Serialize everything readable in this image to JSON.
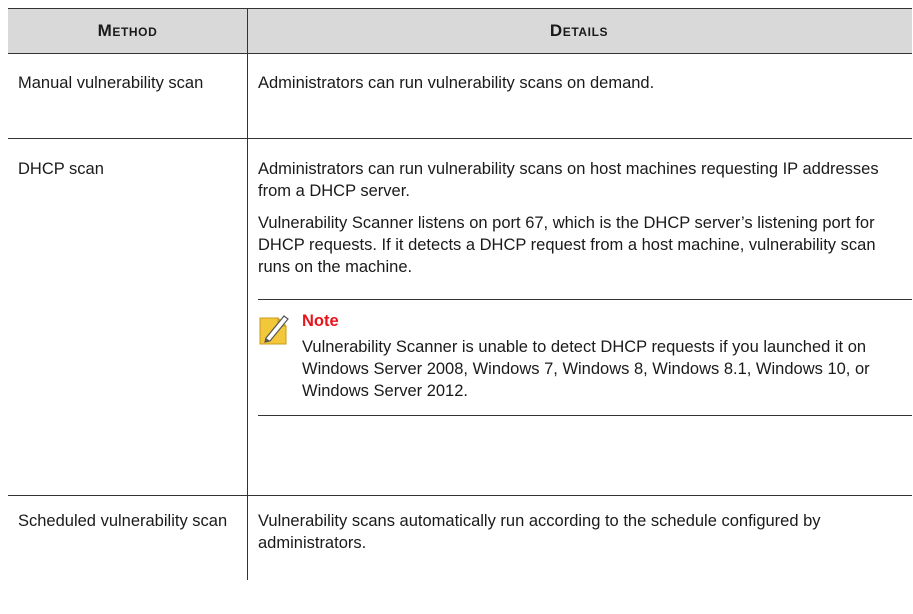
{
  "table": {
    "headers": {
      "method": "Method",
      "details": "Details"
    },
    "rows": [
      {
        "method": "Manual vulnerability scan",
        "details": [
          "Administrators can run vulnerability scans on demand."
        ]
      },
      {
        "method": "DHCP scan",
        "details": [
          "Administrators can run vulnerability scans on host machines requesting IP addresses from a DHCP server.",
          "Vulnerability Scanner listens on port 67, which is the DHCP server’s listening port for DHCP requests. If it detects a DHCP request from a host machine, vulnerability scan runs on the machine."
        ],
        "note": {
          "icon": "note-pencil-icon",
          "title": "Note",
          "text": "Vulnerability Scanner is unable to detect DHCP requests if you launched it on Windows Server 2008, Windows 7, Windows 8, Windows 8.1, Windows 10, or Windows Server 2012."
        }
      },
      {
        "method": "Scheduled vulnerability scan",
        "details": [
          "Vulnerability scans automatically run according to the schedule configured by administrators."
        ]
      }
    ]
  },
  "colors": {
    "header_bg": "#d9d9d9",
    "note_title": "#e8141c",
    "note_icon": "#f2c83a"
  }
}
